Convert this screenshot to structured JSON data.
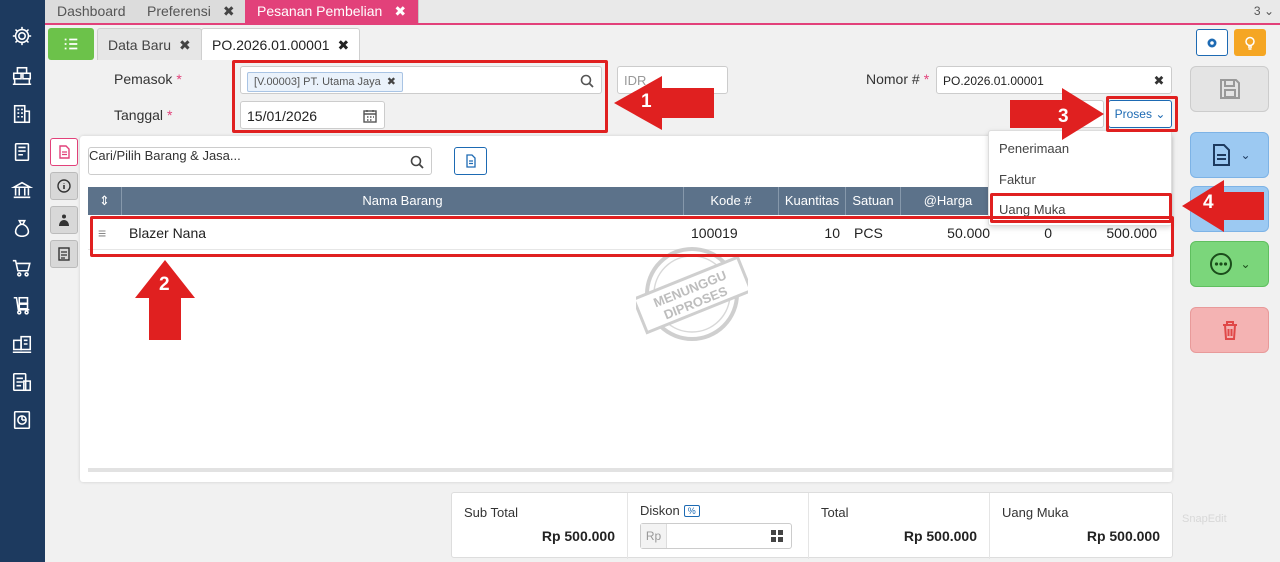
{
  "top_tabs": [
    {
      "label": "Dashboard",
      "closable": false
    },
    {
      "label": "Preferensi",
      "closable": true
    },
    {
      "label": "Pesanan Pembelian",
      "closable": true,
      "active": true
    }
  ],
  "top_tab_count": "3",
  "close_glyph": "✖",
  "sub_tabs": [
    {
      "label": "Data Baru"
    },
    {
      "label": "PO.2026.01.00001",
      "active": true
    }
  ],
  "form": {
    "supplier_label": "Pemasok",
    "supplier_chip": "[V.00003] PT. Utama Jaya",
    "currency_value": "IDR",
    "date_label": "Tanggal",
    "date_value": "15/01/2026",
    "number_label": "Nomor #",
    "number_value": "PO.2026.01.00001",
    "required_mark": "*",
    "process_button": "Proses"
  },
  "process_menu": [
    "Penerimaan",
    "Faktur",
    "Uang Muka"
  ],
  "items": {
    "search_placeholder": "Cari/Pilih Barang & Jasa...",
    "columns": [
      "Nama Barang",
      "Kode #",
      "Kuantitas",
      "Satuan",
      "@Harga"
    ],
    "rows": [
      {
        "name": "Blazer Nana",
        "code": "100019",
        "qty": "10",
        "unit": "PCS",
        "price": "50.000",
        "discount": "0",
        "total": "500.000"
      }
    ]
  },
  "stamp": {
    "line1": "MENUNGGU",
    "line2": "DIPROSES"
  },
  "totals": {
    "subtotal_label": "Sub Total",
    "subtotal_value": "Rp 500.000",
    "discount_label": "Diskon",
    "discount_badge": "%",
    "discount_prefix": "Rp",
    "total_label": "Total",
    "total_value": "Rp 500.000",
    "dp_label": "Uang Muka",
    "dp_value": "Rp 500.000"
  },
  "annotations": [
    "1",
    "2",
    "3",
    "4"
  ],
  "watermark": "SnapEdit",
  "colors": {
    "sidebar": "#1d3a5f",
    "accent": "#e2417a",
    "primary": "#1d6ab3",
    "annotation": "#e02020",
    "table_header": "#5c728a"
  }
}
